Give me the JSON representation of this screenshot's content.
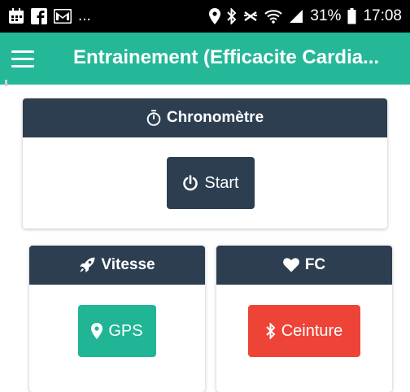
{
  "status_bar": {
    "left_icons": [
      "calendar-icon",
      "facebook-icon",
      "gmail-icon"
    ],
    "overflow": "...",
    "battery": "31%",
    "time": "17:08"
  },
  "app_bar": {
    "title": "Entrainement (Efficacite Cardia..."
  },
  "chrono": {
    "title": "Chronomètre",
    "start_label": "Start"
  },
  "vitesse": {
    "title": "Vitesse",
    "gps_label": "GPS"
  },
  "fc": {
    "title": "FC",
    "ceinture_label": "Ceinture"
  },
  "colors": {
    "app_bar": "#24b898",
    "card_header": "#2c3e50",
    "gps_button": "#1fb595",
    "ceinture_button": "#ee4437"
  }
}
